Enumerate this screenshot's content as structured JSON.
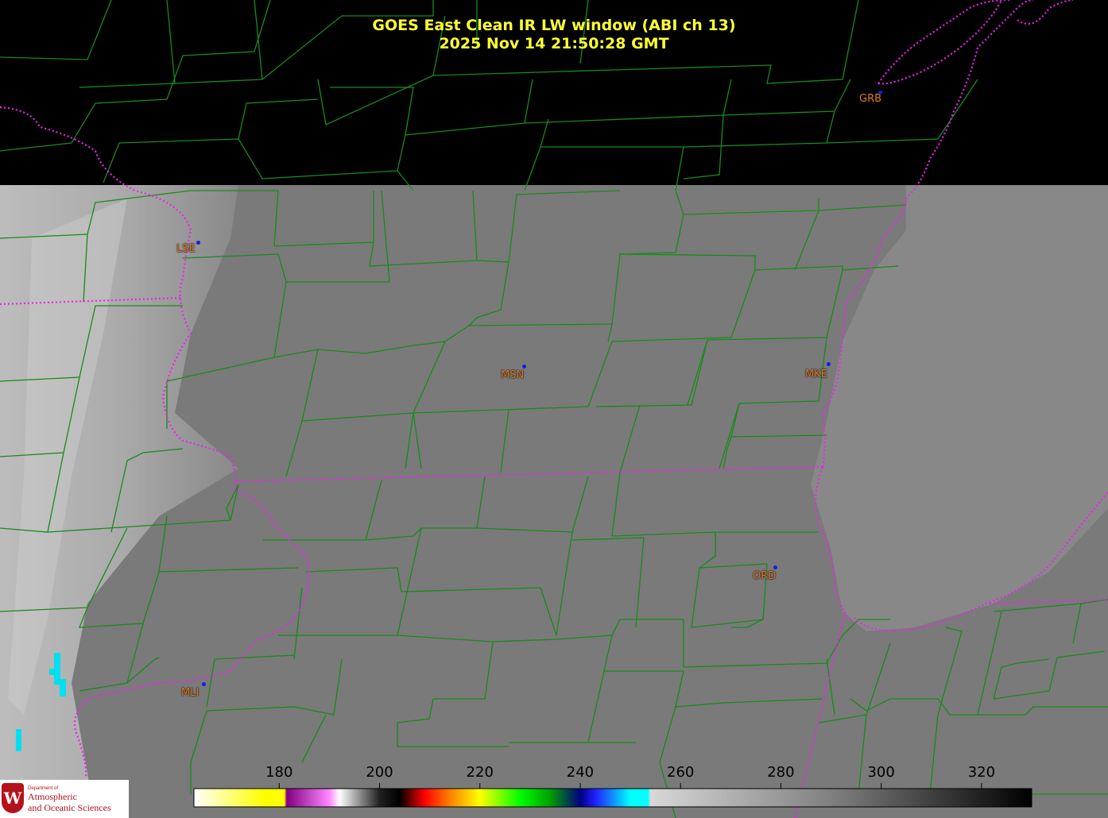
{
  "title": {
    "line1": "GOES East Clean IR LW window (ABI ch 13)",
    "line2": "2025 Nov 14  21:50:28 GMT"
  },
  "colors": {
    "title": "#ffff33",
    "county_lines": "#1a8a1a",
    "state_lines": "#ee22ee",
    "city_label": "#e07a1e",
    "city_dot": "#1020e0",
    "no_data": "#000000",
    "ir_background": "#7a7a7a",
    "lake_michigan": "#888888"
  },
  "cities": [
    {
      "id": "GRB",
      "label": "GRB"
    },
    {
      "id": "LSE",
      "label": "LSE"
    },
    {
      "id": "MSN",
      "label": "MSN"
    },
    {
      "id": "MKE",
      "label": "MKE"
    },
    {
      "id": "ORD",
      "label": "ORD"
    },
    {
      "id": "MLI",
      "label": "MLI"
    }
  ],
  "colorbar": {
    "ticks": [
      "180",
      "200",
      "220",
      "240",
      "260",
      "280",
      "300",
      "320"
    ],
    "min": 163,
    "max": 330,
    "stops": [
      {
        "t": 163,
        "c": "#ffffff"
      },
      {
        "t": 177,
        "c": "#ffff00"
      },
      {
        "t": 181,
        "c": "#ffff00"
      },
      {
        "t": 181.5,
        "c": "#800080"
      },
      {
        "t": 190,
        "c": "#ff88ff"
      },
      {
        "t": 192,
        "c": "#ffffff"
      },
      {
        "t": 200,
        "c": "#202020"
      },
      {
        "t": 204,
        "c": "#000000"
      },
      {
        "t": 209,
        "c": "#ff0000"
      },
      {
        "t": 214,
        "c": "#ff8000"
      },
      {
        "t": 220,
        "c": "#ffff00"
      },
      {
        "t": 228,
        "c": "#00ff00"
      },
      {
        "t": 234,
        "c": "#00a000"
      },
      {
        "t": 240,
        "c": "#000080"
      },
      {
        "t": 243,
        "c": "#2020ff"
      },
      {
        "t": 250,
        "c": "#00ffff"
      },
      {
        "t": 253.5,
        "c": "#00ffff"
      },
      {
        "t": 254,
        "c": "#d8d8d8"
      },
      {
        "t": 290,
        "c": "#808080"
      },
      {
        "t": 330,
        "c": "#000000"
      }
    ]
  },
  "logo": {
    "department": "Department of",
    "name_line1": "Atmospheric",
    "name_line2": "and Oceanic Sciences",
    "crest_letter": "W"
  }
}
